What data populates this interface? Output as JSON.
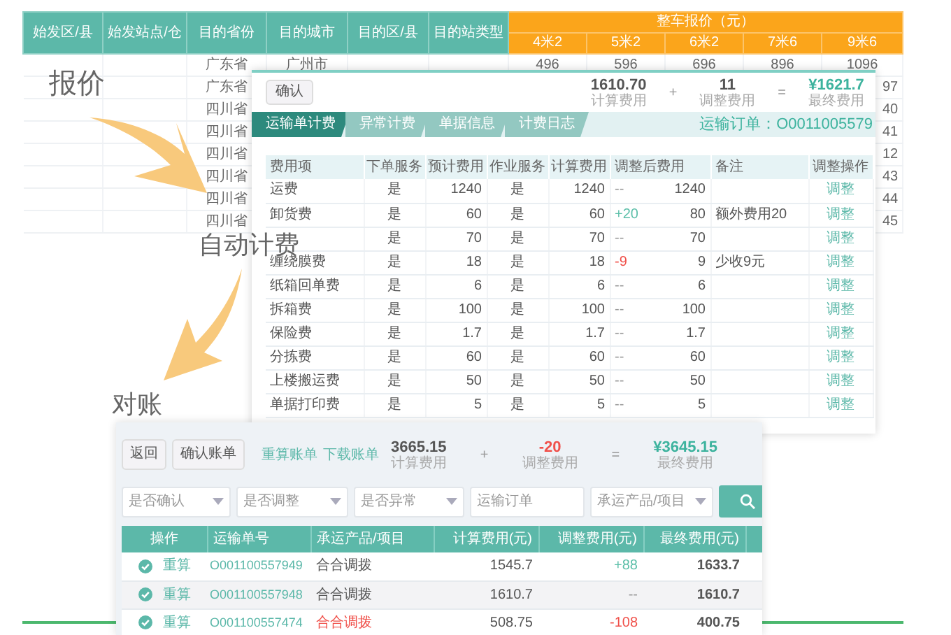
{
  "annotations": [
    {
      "text": "报价"
    },
    {
      "text": "自动计费"
    },
    {
      "text": "对账"
    }
  ],
  "quote_table": {
    "columns": [
      "始发区/县",
      "始发站点/仓",
      "目的省份",
      "目的城市",
      "目的区/县",
      "目的站类型"
    ],
    "price_group": "整车报价（元）",
    "price_columns": [
      "4米2",
      "5米2",
      "6米2",
      "7米6",
      "9米6"
    ],
    "rows": [
      {
        "province": "广东省",
        "city": "广州市",
        "prices": [
          "496",
          "596",
          "696",
          "896",
          "1096"
        ]
      },
      {
        "province": "广东省",
        "tail": "97"
      },
      {
        "province": "四川省",
        "tail": "40"
      },
      {
        "province": "四川省",
        "tail": "41"
      },
      {
        "province": "四川省",
        "tail": "12"
      },
      {
        "province": "四川省",
        "tail": "43"
      },
      {
        "province": "四川省",
        "tail": "44"
      },
      {
        "province": "四川省",
        "tail": "45"
      }
    ]
  },
  "billing": {
    "confirm_button": "确认",
    "summary": [
      {
        "kind": "value",
        "value": "1610.70",
        "label": "计算费用"
      },
      {
        "kind": "operator",
        "text": "+"
      },
      {
        "kind": "value",
        "value": "11",
        "label": "调整费用"
      },
      {
        "kind": "operator",
        "text": "="
      },
      {
        "kind": "total",
        "value": "¥1621.7",
        "label": "最终费用"
      }
    ],
    "tabs": [
      {
        "label": "运输单计费",
        "selected": true
      },
      {
        "label": "异常计费",
        "selected": false
      },
      {
        "label": "单据信息",
        "selected": false
      },
      {
        "label": "计费日志",
        "selected": false
      }
    ],
    "order_label": "运输订单：O0011005579",
    "columns": [
      "费用项",
      "下单服务",
      "预计费用",
      "作业服务",
      "计算费用",
      "调整后费用",
      "备注",
      "调整操作"
    ],
    "rows": [
      {
        "item": "运费",
        "order_service": "是",
        "estimated": "1240",
        "work_service": "是",
        "computed": "1240",
        "adjust": "--",
        "kind": "unchanged",
        "adjusted": "1240",
        "action": "调整"
      },
      {
        "item": "卸货费",
        "order_service": "是",
        "estimated": "60",
        "work_service": "是",
        "computed": "60",
        "adjust": "+20",
        "kind": "increase",
        "adjusted": "80",
        "note": "额外费用20",
        "action": "调整"
      },
      {
        "order_service": "是",
        "estimated": "70",
        "work_service": "是",
        "computed": "70",
        "adjust": "--",
        "kind": "unchanged",
        "adjusted": "70",
        "action": "调整"
      },
      {
        "item": "缠绕膜费",
        "order_service": "是",
        "estimated": "18",
        "work_service": "是",
        "computed": "18",
        "adjust": "-9",
        "kind": "decrease",
        "adjusted": "9",
        "note": "少收9元",
        "action": "调整"
      },
      {
        "item": "纸箱回单费",
        "order_service": "是",
        "estimated": "6",
        "work_service": "是",
        "computed": "6",
        "adjust": "--",
        "kind": "unchanged",
        "adjusted": "6",
        "action": "调整"
      },
      {
        "item": "拆箱费",
        "order_service": "是",
        "estimated": "100",
        "work_service": "是",
        "computed": "100",
        "adjust": "--",
        "kind": "unchanged",
        "adjusted": "100",
        "action": "调整"
      },
      {
        "item": "保险费",
        "order_service": "是",
        "estimated": "1.7",
        "work_service": "是",
        "computed": "1.7",
        "adjust": "--",
        "kind": "unchanged",
        "adjusted": "1.7",
        "action": "调整"
      },
      {
        "item": "分拣费",
        "order_service": "是",
        "estimated": "60",
        "work_service": "是",
        "computed": "60",
        "adjust": "--",
        "kind": "unchanged",
        "adjusted": "60",
        "action": "调整"
      },
      {
        "item": "上楼搬运费",
        "order_service": "是",
        "estimated": "50",
        "work_service": "是",
        "computed": "50",
        "adjust": "--",
        "kind": "unchanged",
        "adjusted": "50",
        "action": "调整"
      },
      {
        "item": "单据打印费",
        "order_service": "是",
        "estimated": "5",
        "work_service": "是",
        "computed": "5",
        "adjust": "--",
        "kind": "unchanged",
        "adjusted": "5",
        "action": "调整"
      }
    ]
  },
  "reconcile": {
    "buttons": [
      "返回",
      "确认账单"
    ],
    "links": [
      "重算账单",
      "下载账单"
    ],
    "summary": [
      {
        "kind": "value",
        "value": "3665.15",
        "label": "计算费用"
      },
      {
        "kind": "operator",
        "text": "+"
      },
      {
        "kind": "negative",
        "value": "-20",
        "label": "调整费用"
      },
      {
        "kind": "operator",
        "text": "="
      },
      {
        "kind": "total",
        "value": "¥3645.15",
        "label": "最终费用"
      }
    ],
    "filters": [
      {
        "kind": "select",
        "placeholder": "是否确认"
      },
      {
        "kind": "select",
        "placeholder": "是否调整"
      },
      {
        "kind": "select",
        "placeholder": "是否异常"
      },
      {
        "kind": "input",
        "placeholder": "运输订单"
      },
      {
        "kind": "select",
        "placeholder": "承运产品/项目"
      }
    ],
    "columns": [
      "操作",
      "运输单号",
      "承运产品/项目",
      "计算费用(元)",
      "调整费用(元)",
      "最终费用(元)"
    ],
    "rows": [
      {
        "action": "重算",
        "order": "O001100557949",
        "product": "合合调拨",
        "alert": false,
        "computed": "1545.7",
        "adjust": "+88",
        "kind": "increase",
        "final": "1633.7",
        "highlighted": false
      },
      {
        "action": "重算",
        "order": "O001100557948",
        "product": "合合调拨",
        "alert": false,
        "computed": "1610.7",
        "adjust": "--",
        "kind": "unchanged",
        "final": "1610.7",
        "highlighted": true
      },
      {
        "action": "重算",
        "order": "O001100557474",
        "product": "合合调拨",
        "alert": true,
        "computed": "508.75",
        "adjust": "-108",
        "kind": "decrease",
        "final": "400.75",
        "highlighted": false
      }
    ]
  }
}
